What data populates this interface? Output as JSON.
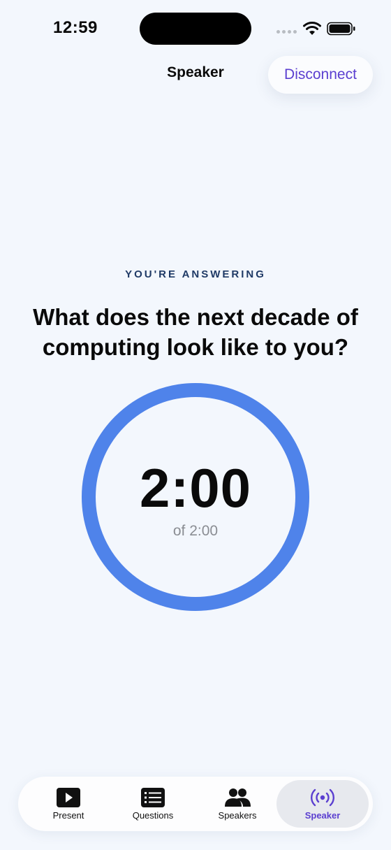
{
  "status_bar": {
    "time": "12:59"
  },
  "nav": {
    "title": "Speaker",
    "disconnect_label": "Disconnect"
  },
  "prompt": {
    "eyebrow": "YOU'RE ANSWERING",
    "question": "What does the next decade of computing look like to you?"
  },
  "timer": {
    "remaining": "2:00",
    "total_label": "of 2:00",
    "progress_fraction": 1.0,
    "ring_color": "#4f83ea"
  },
  "tabs": [
    {
      "label": "Present",
      "icon": "play-icon",
      "active": false
    },
    {
      "label": "Questions",
      "icon": "list-icon",
      "active": false
    },
    {
      "label": "Speakers",
      "icon": "people-icon",
      "active": false
    },
    {
      "label": "Speaker",
      "icon": "broadcast-icon",
      "active": true
    }
  ],
  "colors": {
    "accent": "#5b3fd0",
    "background": "#f3f7fd",
    "eyebrow": "#1f3a66"
  }
}
